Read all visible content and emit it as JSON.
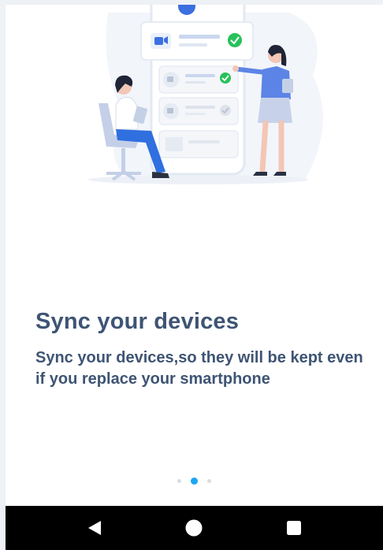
{
  "onboarding": {
    "title": "Sync your devices",
    "description": "Sync your devices,so they will be kept even if you replace your smartphone",
    "page_count": 3,
    "active_page_index": 1
  },
  "illustration": {
    "name": "device-sync-illustration",
    "icons": [
      "video-camera-icon",
      "check-icon"
    ]
  },
  "navbar": {
    "buttons": [
      "back-icon",
      "home-icon",
      "recents-icon"
    ]
  },
  "colors": {
    "text": "#3e5474",
    "accent": "#1ea6f3",
    "check": "#27c15a",
    "video_icon": "#3c6fe0"
  }
}
